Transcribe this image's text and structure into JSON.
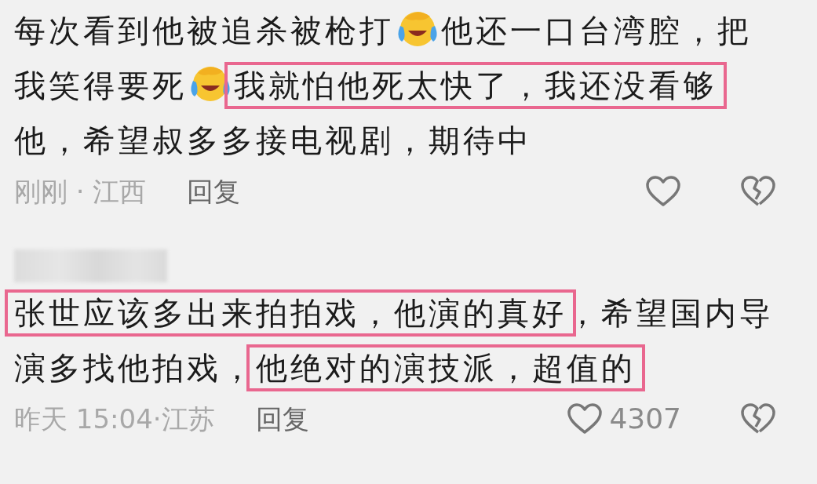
{
  "comments": [
    {
      "segments": [
        {
          "kind": "text",
          "text": "每次看到他被追杀被枪打",
          "highlighted": false
        },
        {
          "kind": "emoji"
        },
        {
          "kind": "text",
          "text": "他还一口台湾腔，把",
          "highlighted": false
        },
        {
          "kind": "text",
          "text": "我笑得要死",
          "highlighted": false
        },
        {
          "kind": "emoji"
        },
        {
          "kind": "text",
          "text": "我就怕他死太快了，我还没看够",
          "highlighted": true
        },
        {
          "kind": "text",
          "text": "他，希望叔多多接电视剧，期待中",
          "highlighted": false
        }
      ],
      "meta": "刚刚 · 江西",
      "reply": "回复"
    },
    {
      "author_blurred": true,
      "segments": [
        {
          "kind": "text",
          "text": "张世应该多出来拍拍戏，他演的真好",
          "highlighted": true
        },
        {
          "kind": "text",
          "text": "，希望国内导",
          "highlighted": false
        },
        {
          "kind": "text",
          "text": "演多找他拍戏，",
          "highlighted": false
        },
        {
          "kind": "text",
          "text": "他绝对的演技派，超值的",
          "highlighted": true
        }
      ],
      "meta": "昨天 15:04·江苏",
      "reply": "回复",
      "likes": "4307"
    }
  ]
}
